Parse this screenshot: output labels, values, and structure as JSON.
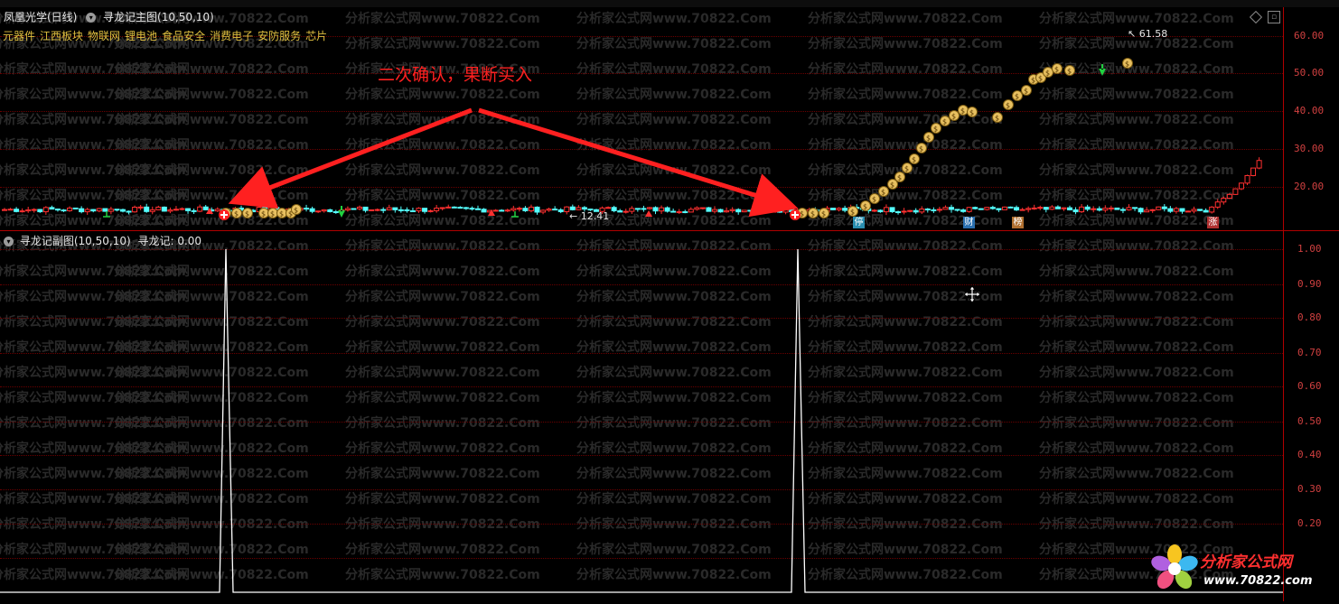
{
  "header": {
    "stock_name": "凤凰光学(日线)",
    "main_indicator": "寻龙记主图(10,50,10)"
  },
  "concepts": [
    "元器件",
    "江西板块",
    "物联网",
    "锂电池",
    "食品安全",
    "消费电子",
    "安防服务",
    "芯片"
  ],
  "annotation": "二次确认，果断买入",
  "price_labels": {
    "high": "61.58",
    "low": "12.41"
  },
  "main_axis": [
    "60.00",
    "50.00",
    "40.00",
    "30.00",
    "20.00"
  ],
  "sub_header": {
    "indicator": "寻龙记副图(10,50,10)",
    "value_label": "寻龙记: 0.00"
  },
  "sub_axis": [
    "1.00",
    "0.90",
    "0.80",
    "0.70",
    "0.60",
    "0.50",
    "0.40",
    "0.30",
    "0.20"
  ],
  "badges": [
    "停",
    "财",
    "榜",
    "涨"
  ],
  "watermark": "分析家公式网www.70822.Com",
  "logo": {
    "name": "分析家公式网",
    "url": "www.70822.com"
  },
  "colors": {
    "up": "#ff3030",
    "down": "#54ffff",
    "axis": "#b00000",
    "annotation": "#ff2020"
  }
}
